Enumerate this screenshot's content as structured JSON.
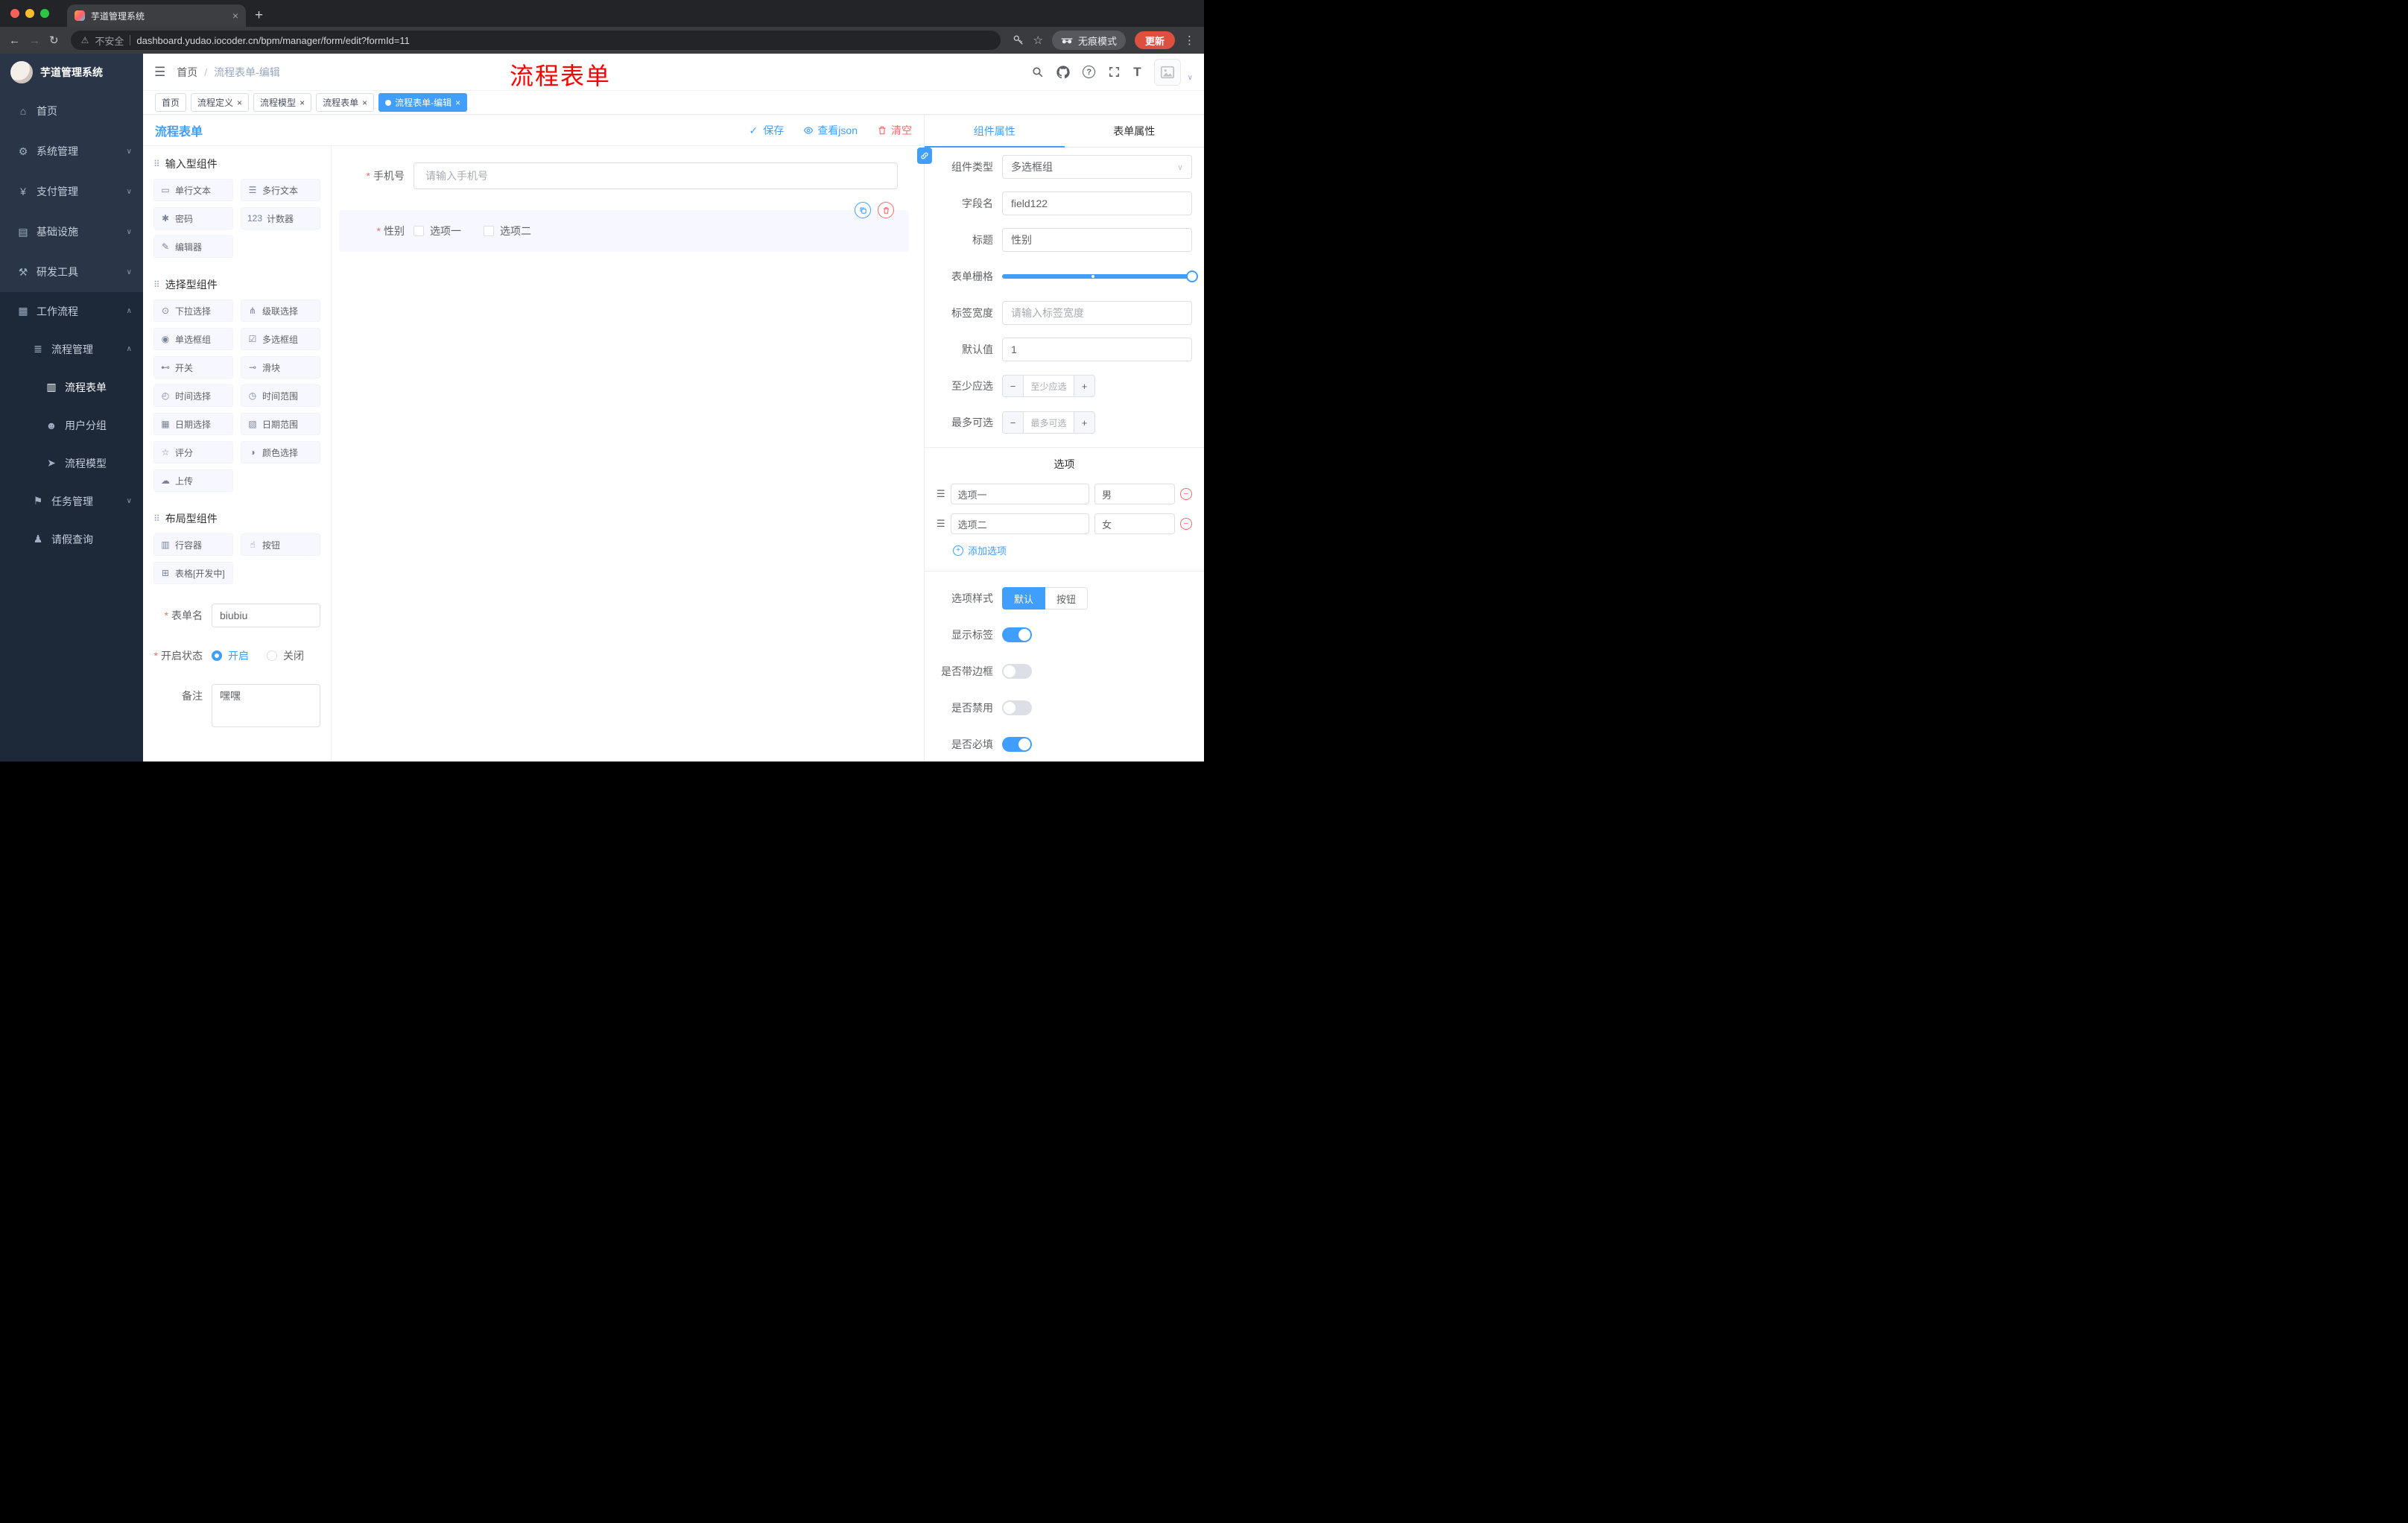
{
  "colors": {
    "primary": "#409eff",
    "danger": "#f56c6c",
    "annotation": "#ff0000",
    "sidebar_bg": "#2a3648",
    "sidebar_sub_bg": "#1d2838",
    "tag_active": "#409eff"
  },
  "icons": {
    "close": "×",
    "plus": "+",
    "minus": "−",
    "back": "←",
    "forward": "→",
    "reload": "↻",
    "warning": "⚠",
    "star": "☆",
    "dots": "⋮",
    "hamburger": "☰",
    "caret_down": "∨",
    "check": "✓",
    "section": "⠿",
    "drag": "☰",
    "help": "?",
    "size": "T"
  },
  "browser": {
    "tab_title": "芋道管理系统",
    "security": "不安全",
    "url": "dashboard.yudao.iocoder.cn/bpm/manager/form/edit?formId=11",
    "incognito": "无痕模式",
    "update": "更新"
  },
  "sidebar": {
    "logo": "芋道管理系统",
    "menu_top": [
      {
        "label": "首页",
        "glyph": "⌂",
        "icon": "dashboard-icon",
        "level": "0"
      },
      {
        "label": "系统管理",
        "glyph": "⚙",
        "icon": "system-management-icon",
        "level": "0",
        "arrow": "∨"
      },
      {
        "label": "支付管理",
        "glyph": "¥",
        "icon": "payment-management-icon",
        "level": "0",
        "arrow": "∨"
      },
      {
        "label": "基础设施",
        "glyph": "▤",
        "icon": "infrastructure-icon",
        "level": "0",
        "arrow": "∨"
      },
      {
        "label": "研发工具",
        "glyph": "⚒",
        "icon": "devtools-icon",
        "level": "0",
        "arrow": "∨"
      }
    ],
    "menu_workflow": [
      {
        "label": "工作流程",
        "glyph": "▦",
        "icon": "workflow-icon",
        "level": "0",
        "arrow": "∧"
      },
      {
        "label": "流程管理",
        "glyph": "≣",
        "icon": "process-management-icon",
        "level": "1",
        "arrow": "∧"
      },
      {
        "label": "流程表单",
        "glyph": "▥",
        "icon": "process-form-icon",
        "level": "2",
        "active": true
      },
      {
        "label": "用户分组",
        "glyph": "☻",
        "icon": "user-group-icon",
        "level": "2"
      },
      {
        "label": "流程模型",
        "glyph": "➤",
        "icon": "process-model-icon",
        "level": "2"
      },
      {
        "label": "任务管理",
        "glyph": "⚑",
        "icon": "task-management-icon",
        "level": "1",
        "arrow": "∨"
      },
      {
        "label": "请假查询",
        "glyph": "♟",
        "icon": "leave-query-icon",
        "level": "1"
      }
    ]
  },
  "header": {
    "breadcrumb_root": "首页",
    "breadcrumb_sep": "/",
    "breadcrumb_current": "流程表单-编辑",
    "annotation": "流程表单"
  },
  "tags": [
    {
      "label": "首页"
    },
    {
      "label": "流程定义",
      "closable": true
    },
    {
      "label": "流程模型",
      "closable": true
    },
    {
      "label": "流程表单",
      "closable": true
    },
    {
      "label": "流程表单-编辑",
      "closable": true,
      "active": true
    }
  ],
  "designer": {
    "title": "流程表单",
    "save": "保存",
    "view_json": "查看json",
    "clear": "清空"
  },
  "components": {
    "input_section": {
      "title": "输入型组件",
      "items": [
        {
          "label": "单行文本",
          "glyph": "▭",
          "icon": "single-line-text-icon"
        },
        {
          "label": "多行文本",
          "glyph": "☰",
          "icon": "multi-line-text-icon"
        },
        {
          "label": "密码",
          "glyph": "✱",
          "icon": "password-lock-icon"
        },
        {
          "label": "计数器",
          "glyph": "123",
          "icon": "counter-icon"
        },
        {
          "label": "编辑器",
          "glyph": "✎",
          "icon": "editor-icon"
        }
      ]
    },
    "select_section": {
      "title": "选择型组件",
      "items": [
        {
          "label": "下拉选择",
          "glyph": "⊙",
          "icon": "dropdown-select-icon"
        },
        {
          "label": "级联选择",
          "glyph": "⋔",
          "icon": "cascade-select-icon"
        },
        {
          "label": "单选框组",
          "glyph": "◉",
          "icon": "radio-group-icon"
        },
        {
          "label": "多选框组",
          "glyph": "☑",
          "icon": "checkbox-group-icon"
        },
        {
          "label": "开关",
          "glyph": "⊷",
          "icon": "switch-component-icon"
        },
        {
          "label": "滑块",
          "glyph": "⊸",
          "icon": "slider-component-icon"
        },
        {
          "label": "时间选择",
          "glyph": "◴",
          "icon": "time-picker-icon"
        },
        {
          "label": "时间范围",
          "glyph": "◷",
          "icon": "time-range-icon"
        },
        {
          "label": "日期选择",
          "glyph": "▦",
          "icon": "date-picker-icon"
        },
        {
          "label": "日期范围",
          "glyph": "▧",
          "icon": "date-range-icon"
        },
        {
          "label": "评分",
          "glyph": "☆",
          "icon": "rate-icon"
        },
        {
          "label": "颜色选择",
          "glyph": "◑",
          "icon": "color-picker-icon"
        },
        {
          "label": "上传",
          "glyph": "☁",
          "icon": "upload-icon"
        }
      ]
    },
    "layout_section": {
      "title": "布局型组件",
      "items": [
        {
          "label": "行容器",
          "glyph": "▥",
          "icon": "row-container-icon"
        },
        {
          "label": "按钮",
          "glyph": "☝",
          "icon": "button-component-icon"
        },
        {
          "label": "表格[开发中]",
          "glyph": "⊞",
          "icon": "table-component-icon"
        }
      ]
    },
    "form": {
      "name_label": "表单名",
      "name_value": "biubiu",
      "status_label": "开启状态",
      "status_on": "开启",
      "status_off": "关闭",
      "remark_label": "备注",
      "remark_value": "嘿嘿"
    }
  },
  "canvas": {
    "phone": {
      "label": "手机号",
      "placeholder": "请输入手机号"
    },
    "gender": {
      "label": "性别",
      "options": [
        {
          "label": "选项一"
        },
        {
          "label": "选项二"
        }
      ]
    }
  },
  "props": {
    "tab_component": "组件属性",
    "tab_form": "表单属性",
    "component_type_label": "组件类型",
    "component_type_value": "多选框组",
    "field_name_label": "字段名",
    "field_name_value": "field122",
    "title_label": "标题",
    "title_value": "性别",
    "grid_label": "表单栅格",
    "label_width_label": "标签宽度",
    "label_width_placeholder": "请输入标签宽度",
    "default_label": "默认值",
    "default_value": "1",
    "min_label": "至少应选",
    "min_placeholder": "至少应选",
    "max_label": "最多可选",
    "max_placeholder": "最多可选",
    "options_title": "选项",
    "options": [
      {
        "name": "选项一",
        "value": "男"
      },
      {
        "name": "选项二",
        "value": "女"
      }
    ],
    "add_option": "添加选项",
    "style_label": "选项样式",
    "style_default": "默认",
    "style_button": "按钮",
    "switches": [
      {
        "label": "显示标签",
        "on": true
      },
      {
        "label": "是否带边框",
        "on": false
      },
      {
        "label": "是否禁用",
        "on": false
      },
      {
        "label": "是否必填",
        "on": true
      }
    ]
  }
}
